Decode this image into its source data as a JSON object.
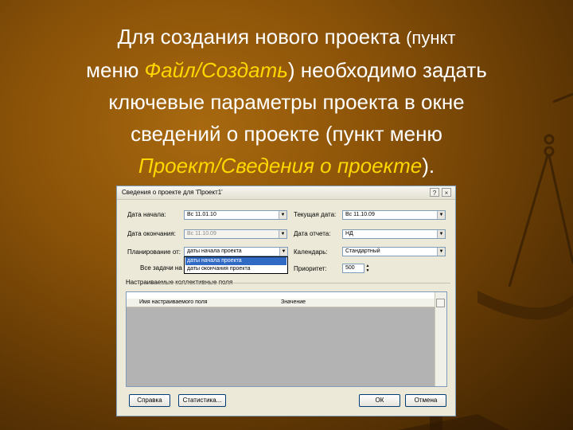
{
  "slide": {
    "line1_main": "Для создания нового проекта ",
    "line1_small": "(пункт",
    "line2_pre": "меню ",
    "line2_accent": "Файл/Создать",
    "line2_post": ") необходимо задать",
    "line3": "ключевые параметры проекта в окне",
    "line4": "сведений о проекте (пункт меню",
    "line5_accent": "Проект/Сведения о проекте",
    "line5_post": ")."
  },
  "dialog": {
    "title": "Сведения о проекте для 'Проект1'",
    "help_label": "?",
    "close_label": "×",
    "start_date_label": "Дата начала:",
    "start_date_value": "Вс 11.01.10",
    "finish_date_label": "Дата окончания:",
    "finish_date_value": "Вс 11.10.09",
    "schedule_from_label": "Планирование от:",
    "schedule_from_value": "даты начала проекта",
    "schedule_options": [
      "даты начала проекта",
      "даты окончания проекта"
    ],
    "all_tasks_label": "Все задачи на",
    "current_date_label": "Текущая дата:",
    "current_date_value": "Вс 11.10.09",
    "status_date_label": "Дата отчета:",
    "status_date_value": "НД",
    "calendar_label": "Календарь:",
    "calendar_value": "Стандартный",
    "priority_label": "Приоритет:",
    "priority_value": "500",
    "custom_fields_label": "Настраиваемые коллективные поля",
    "col_name": "Имя настраиваемого поля",
    "col_value": "Значение",
    "help_button": "Справка",
    "stats_button": "Статистика...",
    "ok_button": "ОК",
    "cancel_button": "Отмена"
  },
  "colors": {
    "accent_text": "#ffd700",
    "selection": "#316ac5"
  }
}
